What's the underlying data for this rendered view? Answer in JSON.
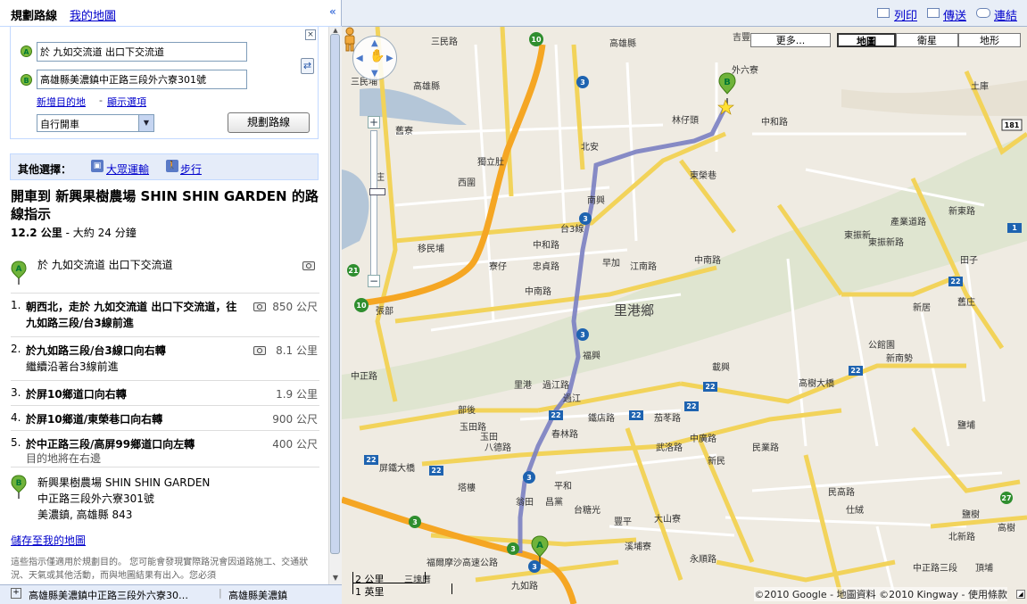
{
  "left_tabs": {
    "plan_route": "規劃路線",
    "my_maps": "我的地圖",
    "collapse": "«"
  },
  "directions": {
    "marker_a": "A",
    "marker_b": "B",
    "start_value": "於 九如交流道 出口下交流道",
    "end_value": "高雄縣美濃鎮中正路三段外六寮301號",
    "clear": "×",
    "swap": "⇄",
    "add_destination": "新增目的地",
    "separator": "-",
    "show_options": "顯示選項",
    "travel_mode": "自行開車",
    "submit": "規劃路線"
  },
  "alternatives": {
    "label": "其他選擇：",
    "transit": "大眾運輸",
    "walking": "步行"
  },
  "route": {
    "title": "開車到 新興果樹農場 SHIN SHIN GARDEN 的路線指示",
    "distance": "12.2 公里",
    "separator": "-",
    "duration": "大約 24 分鐘",
    "start_label": "於 九如交流道 出口下交流道",
    "steps": [
      {
        "num": "1.",
        "text": "朝西北，走於 九如交流道 出口下交流道，往九如路三段/台3線前進",
        "dist": "850 公尺"
      },
      {
        "num": "2.",
        "text": "於九如路三段/台3線口向右轉",
        "text2": "繼續沿著台3線前進",
        "dist": "8.1 公里"
      },
      {
        "num": "3.",
        "text": "於屏10鄉道口向右轉",
        "dist": "1.9 公里"
      },
      {
        "num": "4.",
        "text": "於屏10鄉道/東榮巷口向右轉",
        "dist": "900 公尺"
      },
      {
        "num": "5.",
        "text": "於中正路三段/高屏99鄉道口向左轉",
        "text2": "目的地將在右邊",
        "dist": "400 公尺"
      }
    ],
    "end_name": "新興果樹農場 SHIN SHIN GARDEN",
    "end_addr1": "中正路三段外六寮301號",
    "end_addr2": "美濃鎮, 高雄縣 843",
    "save": "儲存至我的地圖",
    "disclaimer": "這些指示僅適用於規劃目的。 您可能會發現實際路況會因道路施工、交通狀況、天氣或其他活動，而與地圖結果有出入。您必須"
  },
  "footer": {
    "plus": "+",
    "tab1": "高雄縣美濃鎮中正路三段外六寮30…",
    "sep": "|",
    "tab2": "高雄縣美濃鎮"
  },
  "map_toolbar": {
    "print": "列印",
    "send": "傳送",
    "link": "連結"
  },
  "map_types": {
    "more": "更多...",
    "map": "地圖",
    "satellite": "衛星",
    "terrain": "地形"
  },
  "map_labels": {
    "village": "里港鄉",
    "places": [
      "吉豐",
      "外六寮",
      "林仔頭",
      "北安",
      "獨立肚",
      "西圍",
      "庄",
      "南興",
      "中和路",
      "中和路",
      "移民埔",
      "早加",
      "忠貞路",
      "江南路",
      "寮仔",
      "中南路",
      "中南路",
      "張部",
      "福興",
      "里港",
      "過江路",
      "過江",
      "部後",
      "玉田路",
      "玉田",
      "八德路",
      "春林路",
      "鐵店路",
      "茄苳路",
      "載興",
      "高樹大橋",
      "屏鐵大橋",
      "塔樓",
      "平和",
      "翁田",
      "昌黨",
      "台糖光",
      "豐平",
      "大山寮",
      "溪埔寮",
      "新民",
      "武洛路",
      "中廣路",
      "民業路",
      "永順路",
      "仕絨",
      "民高路",
      "田子",
      "新居",
      "新南勢",
      "公館園",
      "舊庄",
      "東振新",
      "東振新路",
      "產業道路",
      "新東路",
      "三民路",
      "三民埔",
      "中正路",
      "九如路",
      "三塊厝",
      "北新路",
      "高樹",
      "福爾摩沙高速公路",
      "鹽樹",
      "頂埔",
      "東榮巷",
      "台3線",
      "中正路三段",
      "土庫",
      "鹽埔",
      "舊寮",
      "高雄縣",
      "高雄縣"
    ],
    "shields": [
      "10",
      "3",
      "3",
      "3",
      "3",
      "3",
      "21",
      "10",
      "22",
      "22",
      "22",
      "22",
      "22",
      "22",
      "22",
      "22",
      "181",
      "27",
      "3",
      "1",
      "3"
    ]
  },
  "scale": {
    "km": "2 公里",
    "mi": "1 英里"
  },
  "copyright": "©2010 Google - 地圖資料 ©2010 Kingway - 使用條款",
  "colors": {
    "route": "#7a7fc2",
    "highway": "#f5a623",
    "road": "#ffe55a",
    "map_bg": "#efebe2",
    "marker": "#7cba3c",
    "link": "#0000cc"
  }
}
